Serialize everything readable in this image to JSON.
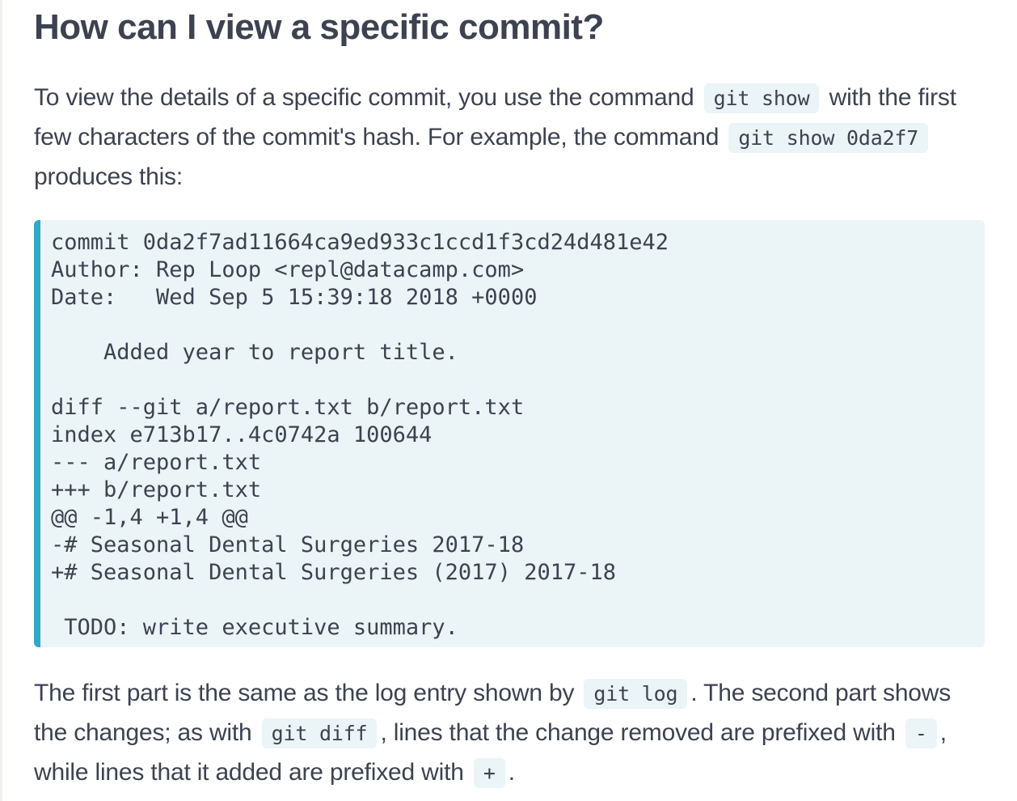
{
  "heading": "How can I view a specific commit?",
  "intro": {
    "t1": "To view the details of a specific commit, you use the command ",
    "c1": "git show",
    "t2": " with the first few characters of the commit's hash. For example, the command ",
    "c2": "git show 0da2f7",
    "t3": " produces this:"
  },
  "code_block": {
    "lines": [
      "commit 0da2f7ad11664ca9ed933c1ccd1f3cd24d481e42",
      "Author: Rep Loop <repl@datacamp.com>",
      "Date:   Wed Sep 5 15:39:18 2018 +0000",
      "",
      "    Added year to report title.",
      "",
      "diff --git a/report.txt b/report.txt",
      "index e713b17..4c0742a 100644",
      "--- a/report.txt",
      "+++ b/report.txt",
      "@@ -1,4 +1,4 @@",
      "-# Seasonal Dental Surgeries 2017-18",
      "+# Seasonal Dental Surgeries (2017) 2017-18",
      "",
      " TODO: write executive summary."
    ]
  },
  "outro": {
    "t1": "The first part is the same as the log entry shown by ",
    "c1": "git log",
    "t2": ". The second part shows the changes; as with ",
    "c2": "git diff",
    "t3": ", lines that the change removed are prefixed with ",
    "c3": "-",
    "t4": ", while lines that it added are prefixed with ",
    "c4": "+",
    "t5": "."
  },
  "colors": {
    "text": "#3d4251",
    "code_bg": "#ebf4f7",
    "accent_border": "#2fa8c9"
  }
}
